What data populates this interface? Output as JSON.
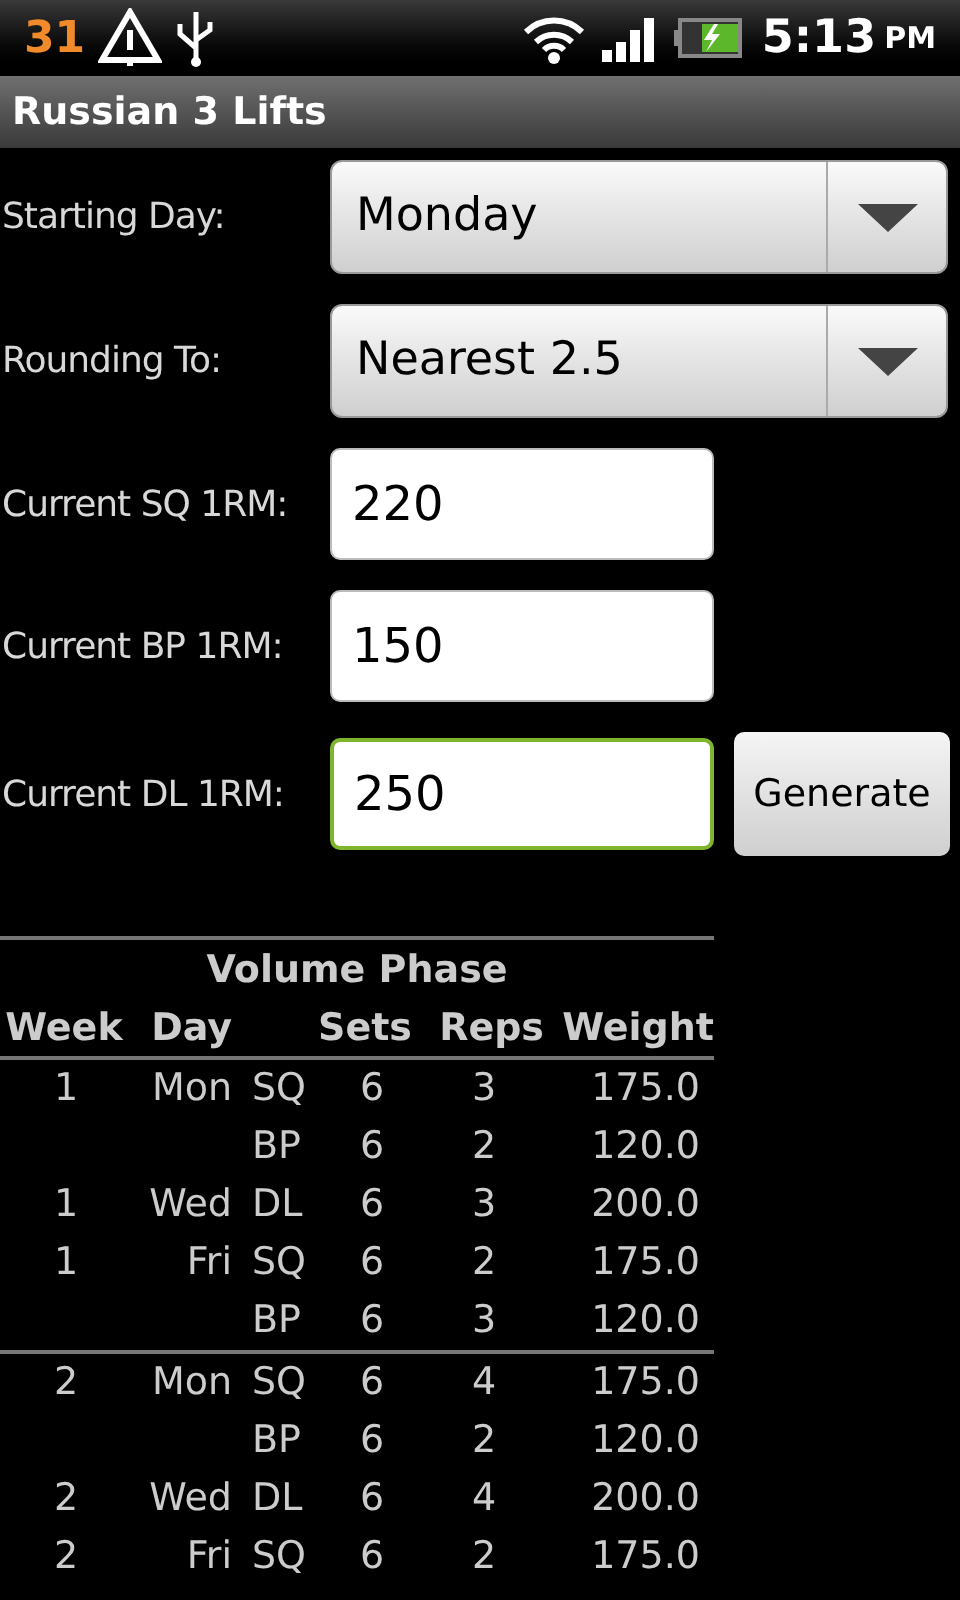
{
  "status_bar": {
    "calendar_badge": "31",
    "time": "5:13",
    "ampm": "PM"
  },
  "window": {
    "title": "Russian 3 Lifts"
  },
  "form": [
    {
      "kind": "spinner",
      "label": "Starting Day:",
      "value": "Monday",
      "focused": false
    },
    {
      "kind": "spinner",
      "label": "Rounding To:",
      "value": "Nearest 2.5",
      "focused": false
    },
    {
      "kind": "input",
      "label": "Current SQ 1RM:",
      "value": "220",
      "focused": false
    },
    {
      "kind": "input",
      "label": "Current BP 1RM:",
      "value": "150",
      "focused": false
    },
    {
      "kind": "input",
      "label": "Current DL 1RM:",
      "value": "250",
      "focused": true,
      "button": "Generate"
    }
  ],
  "table": {
    "title": "Volume Phase",
    "columns": [
      "Week",
      "Day",
      "Sets",
      "Reps",
      "Weight"
    ],
    "groups": [
      {
        "rows": [
          {
            "week": "1",
            "day": "Mon",
            "lift": "SQ",
            "sets": "6",
            "reps": "3",
            "weight": "175.0"
          },
          {
            "lift": "BP",
            "sets": "6",
            "reps": "2",
            "weight": "120.0"
          },
          {
            "week": "1",
            "day": "Wed",
            "lift": "DL",
            "sets": "6",
            "reps": "3",
            "weight": "200.0"
          },
          {
            "week": "1",
            "day": "Fri",
            "lift": "SQ",
            "sets": "6",
            "reps": "2",
            "weight": "175.0"
          },
          {
            "lift": "BP",
            "sets": "6",
            "reps": "3",
            "weight": "120.0"
          }
        ]
      },
      {
        "rows": [
          {
            "week": "2",
            "day": "Mon",
            "lift": "SQ",
            "sets": "6",
            "reps": "4",
            "weight": "175.0"
          },
          {
            "lift": "BP",
            "sets": "6",
            "reps": "2",
            "weight": "120.0"
          },
          {
            "week": "2",
            "day": "Wed",
            "lift": "DL",
            "sets": "6",
            "reps": "4",
            "weight": "200.0"
          },
          {
            "week": "2",
            "day": "Fri",
            "lift": "SQ",
            "sets": "6",
            "reps": "2",
            "weight": "175.0"
          }
        ]
      }
    ]
  }
}
